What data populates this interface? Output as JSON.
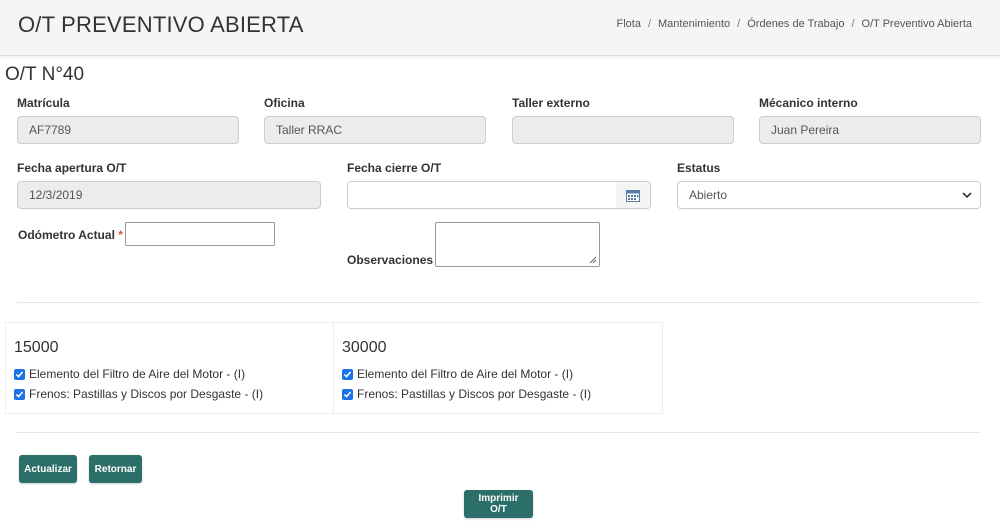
{
  "header": {
    "title": "O/T PREVENTIVO ABIERTA",
    "breadcrumb": [
      "Flota",
      "Mantenimiento",
      "Órdenes de Trabajo",
      "O/T Preventivo Abierta"
    ],
    "separator": "/"
  },
  "order": {
    "number": "O/T N°40"
  },
  "fields": {
    "matricula": {
      "label": "Matrícula",
      "value": "AF7789"
    },
    "oficina": {
      "label": "Oficina",
      "value": "Taller RRAC"
    },
    "taller_externo": {
      "label": "Taller externo",
      "value": ""
    },
    "mecanico_interno": {
      "label": "Mécanico interno",
      "value": "Juan Pereira"
    },
    "fecha_apertura": {
      "label": "Fecha apertura O/T",
      "value": "12/3/2019"
    },
    "fecha_cierre": {
      "label": "Fecha cierre O/T",
      "value": ""
    },
    "estatus": {
      "label": "Estatus",
      "value": "Abierto"
    },
    "odometro": {
      "label": "Odómetro Actual",
      "required_mark": "*",
      "value": ""
    },
    "observaciones": {
      "label": "Observaciones",
      "value": ""
    }
  },
  "maintenance": [
    {
      "km": "15000",
      "items": [
        {
          "label": "Elemento del Filtro de Aire del Motor - (I)",
          "checked": true
        },
        {
          "label": "Frenos: Pastillas y Discos por Desgaste - (I)",
          "checked": true
        }
      ]
    },
    {
      "km": "30000",
      "items": [
        {
          "label": "Elemento del Filtro de Aire del Motor - (I)",
          "checked": true
        },
        {
          "label": "Frenos: Pastillas y Discos por Desgaste - (I)",
          "checked": true
        }
      ]
    }
  ],
  "buttons": {
    "update": "Actualizar",
    "back": "Retornar",
    "print": "Imprimir O/T"
  },
  "colors": {
    "button": "#2b6e6a",
    "checkbox": "#1a73e8",
    "header_bg": "#f5f5f5",
    "readonly_bg": "#ececec"
  },
  "icons": {
    "calendar": "calendar-icon",
    "select": "chevron-down-icon",
    "resize": "resize-handle-icon",
    "check": "check-icon"
  }
}
